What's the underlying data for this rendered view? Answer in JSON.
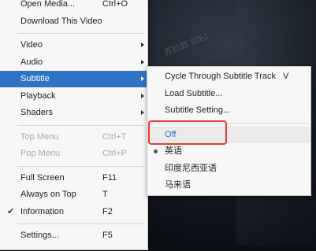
{
  "main_menu": [
    {
      "type": "item",
      "label": "Open Media...",
      "shortcut": "Ctrl+O"
    },
    {
      "type": "item",
      "label": "Download This Video",
      "shortcut": ""
    },
    {
      "type": "sep"
    },
    {
      "type": "item",
      "label": "Video",
      "submenu": true
    },
    {
      "type": "item",
      "label": "Audio",
      "submenu": true
    },
    {
      "type": "item",
      "label": "Subtitle",
      "submenu": true,
      "active": true
    },
    {
      "type": "item",
      "label": "Playback",
      "submenu": true
    },
    {
      "type": "item",
      "label": "Shaders",
      "submenu": true
    },
    {
      "type": "sep"
    },
    {
      "type": "item",
      "label": "Top Menu",
      "shortcut": "Ctrl+T",
      "disabled": true
    },
    {
      "type": "item",
      "label": "Pop Menu",
      "shortcut": "Ctrl+P",
      "disabled": true
    },
    {
      "type": "sep"
    },
    {
      "type": "item",
      "label": "Full Screen",
      "shortcut": "F11"
    },
    {
      "type": "item",
      "label": "Always on Top",
      "shortcut": "T"
    },
    {
      "type": "item",
      "label": "Information",
      "shortcut": "F2",
      "checked": true
    },
    {
      "type": "sep"
    },
    {
      "type": "item",
      "label": "Settings...",
      "shortcut": "F5"
    }
  ],
  "subtitle_menu": [
    {
      "type": "item",
      "label": "Cycle Through Subtitle Track",
      "shortcut": "V"
    },
    {
      "type": "item",
      "label": "Load Subtitle..."
    },
    {
      "type": "item",
      "label": "Subtitle Setting..."
    },
    {
      "type": "sep"
    },
    {
      "type": "item",
      "label": "Off",
      "highlight": true
    },
    {
      "type": "item",
      "label": "英语",
      "selected": true
    },
    {
      "type": "item",
      "label": "印度尼西亚语"
    },
    {
      "type": "item",
      "label": "马来语"
    }
  ],
  "check_glyph": "✔",
  "watermark": "苏妙致 9261",
  "colors": {
    "highlight": "#2f73c5",
    "annotation": "#e43b3b"
  }
}
